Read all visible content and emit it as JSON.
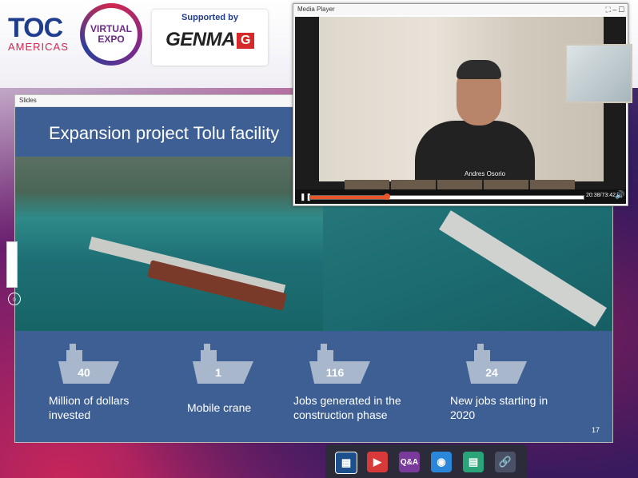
{
  "branding": {
    "toc_main": "TOC",
    "toc_sub": "AMERICAS",
    "expo_line1": "VIRTUAL",
    "expo_line2": "EXPO",
    "supported_by": "Supported by",
    "sponsor": "GENMA",
    "sponsor_mark": "G"
  },
  "slides_window": {
    "title": "Slides",
    "slide": {
      "title": "Expansion project Tolu facility",
      "stats": [
        {
          "value": "40",
          "label": "Million of dollars invested"
        },
        {
          "value": "1",
          "label": "Mobile crane"
        },
        {
          "value": "116",
          "label": "Jobs generated in the construction phase"
        },
        {
          "value": "24",
          "label": "New jobs starting in 2020"
        }
      ],
      "page_number": "17"
    }
  },
  "media_player": {
    "title": "Media Player",
    "window_controls": "⛶ – ☐",
    "speaker_name": "Andres Osorio",
    "time": "20:38/73:42",
    "progress": 0.28,
    "colors": {
      "progress": "#e8562a"
    }
  },
  "dock": {
    "items": [
      {
        "icon": "presentation-icon"
      },
      {
        "icon": "video-icon"
      },
      {
        "icon": "qa-icon",
        "label": "Q&A"
      },
      {
        "icon": "user-icon"
      },
      {
        "icon": "notes-icon"
      },
      {
        "icon": "link-icon"
      }
    ]
  }
}
